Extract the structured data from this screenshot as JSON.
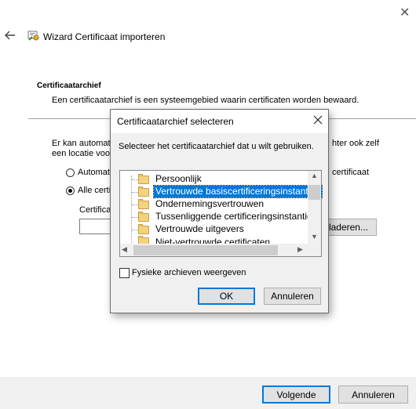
{
  "wizard": {
    "title": "Wizard Certificaat importeren",
    "section_title": "Certificaatarchief",
    "section_desc": "Een certificaatarchief is een systeemgebied waarin certificaten worden bewaard.",
    "body_line1_left": "Er kan automat",
    "body_line1_right": "hter ook zelf",
    "body_line2_left": "een locatie voo",
    "radio_auto_left": "Automati",
    "radio_auto_right": "certificaat",
    "radio_all_left": "Alle certi",
    "cert_label": "Certificat",
    "browse_label": "laderen...",
    "next_label": "Volgende",
    "cancel_label": "Annuleren"
  },
  "dialog": {
    "title": "Certificaatarchief selecteren",
    "instruction": "Selecteer het certificaatarchief dat u wilt gebruiken.",
    "stores": [
      "Persoonlijk",
      "Vertrouwde basiscertificeringsinstanties",
      "Ondernemingsvertrouwen",
      "Tussenliggende certificeringsinstanties",
      "Vertrouwde uitgevers",
      "Niet-vertrouwde certificaten"
    ],
    "selected_index": 1,
    "show_physical_label": "Fysieke archieven weergeven",
    "ok_label": "OK",
    "cancel_label": "Annuleren"
  }
}
